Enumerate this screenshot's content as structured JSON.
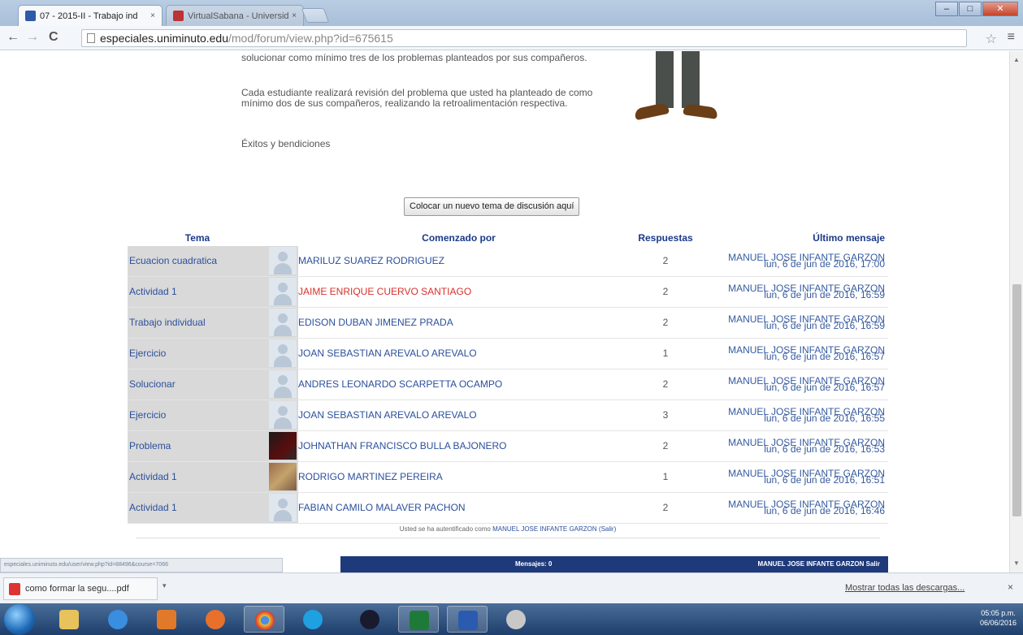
{
  "browser": {
    "tabs": [
      {
        "title": "07 - 2015-II - Trabajo ind",
        "close": "×"
      },
      {
        "title": "VirtualSabana - Universid",
        "close": "×"
      }
    ],
    "url_domain": "especiales.uniminuto.edu",
    "url_path": "/mod/forum/view.php?id=675615",
    "nav_back": "←",
    "nav_forward": "→",
    "nav_reload": "C",
    "star": "☆",
    "menu": "≡",
    "window_controls": [
      "–",
      "□",
      "✕"
    ]
  },
  "intro": {
    "paragraph1": "solucionar como mínimo tres de los problemas planteados por sus compañeros.",
    "paragraph2": "Cada estudiante realizará revisión del problema que usted ha planteado de como mínimo dos de sus compañeros, realizando la retroalimentación respectiva.",
    "paragraph3": "Éxitos y bendiciones"
  },
  "new_topic_button": "Colocar un nuevo tema de discusión aquí",
  "table": {
    "headers": {
      "tema": "Tema",
      "comenzado": "Comenzado por",
      "respuestas": "Respuestas",
      "ultimo": "Último mensaje"
    },
    "rows": [
      {
        "tema": "Ecuacion cuadratica",
        "author": "MARILUZ SUAREZ RODRIGUEZ",
        "replies": "2",
        "last_user": "MANUEL JOSE INFANTE GARZON",
        "last_date": "lun, 6 de jun de 2016, 17:00"
      },
      {
        "tema": "Actividad 1",
        "author": "JAIME ENRIQUE CUERVO SANTIAGO",
        "replies": "2",
        "last_user": "MANUEL JOSE INFANTE GARZON",
        "last_date": "lun, 6 de jun de 2016, 16:59"
      },
      {
        "tema": "Trabajo individual",
        "author": "EDISON DUBAN JIMENEZ PRADA",
        "replies": "2",
        "last_user": "MANUEL JOSE INFANTE GARZON",
        "last_date": "lun, 6 de jun de 2016, 16:59"
      },
      {
        "tema": "Ejercicio",
        "author": "JOAN SEBASTIAN AREVALO AREVALO",
        "replies": "1",
        "last_user": "MANUEL JOSE INFANTE GARZON",
        "last_date": "lun, 6 de jun de 2016, 16:57"
      },
      {
        "tema": "Solucionar",
        "author": "ANDRES LEONARDO SCARPETTA OCAMPO",
        "replies": "2",
        "last_user": "MANUEL JOSE INFANTE GARZON",
        "last_date": "lun, 6 de jun de 2016, 16:57"
      },
      {
        "tema": "Ejercicio",
        "author": "JOAN SEBASTIAN AREVALO AREVALO",
        "replies": "3",
        "last_user": "MANUEL JOSE INFANTE GARZON",
        "last_date": "lun, 6 de jun de 2016, 16:55"
      },
      {
        "tema": "Problema",
        "author": "JOHNATHAN FRANCISCO BULLA BAJONERO",
        "replies": "2",
        "last_user": "MANUEL JOSE INFANTE GARZON",
        "last_date": "lun, 6 de jun de 2016, 16:53"
      },
      {
        "tema": "Actividad 1",
        "author": "RODRIGO MARTINEZ PEREIRA",
        "replies": "1",
        "last_user": "MANUEL JOSE INFANTE GARZON",
        "last_date": "lun, 6 de jun de 2016, 16:51"
      },
      {
        "tema": "Actividad 1",
        "author": "FABIAN CAMILO MALAVER PACHON",
        "replies": "2",
        "last_user": "MANUEL JOSE INFANTE GARZON",
        "last_date": "lun, 6 de jun de 2016, 16:46"
      }
    ]
  },
  "login_info": {
    "prefix": "Usted se ha autentificado como",
    "user": "MANUEL JOSE INFANTE GARZON",
    "logout": "(Salir)"
  },
  "bottom_bar": {
    "messages": "Mensajes: 0",
    "who": "MANUEL JOSE INFANTE GARZON Salir"
  },
  "status_url": "especiales.uniminuto.edu/user/view.php?id=88496&course=7066",
  "downloads": {
    "file": "como formar la segu....pdf",
    "show_all": "Mostrar todas las descargas...",
    "close": "×",
    "arrow": "▾"
  },
  "clock": {
    "time": "05:05 p.m.",
    "date": "06/06/2016"
  },
  "colors": {
    "link": "#2b4f9c",
    "highlight_author": "#d9302a",
    "header": "#1b3a88",
    "tema_bg": "#d9d9d9"
  }
}
